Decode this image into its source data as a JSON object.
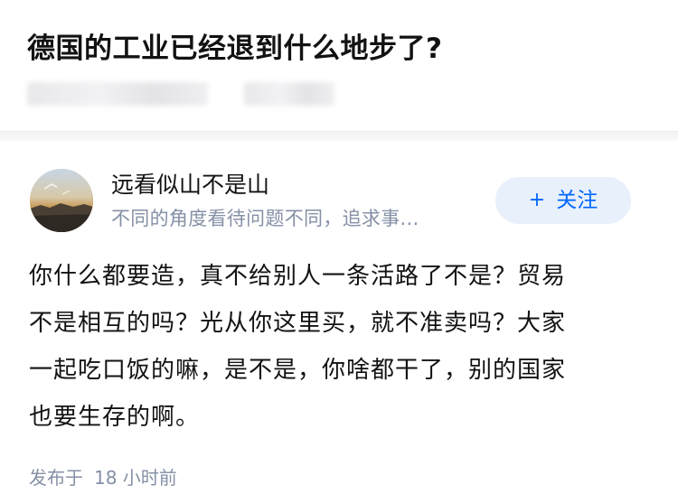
{
  "question": {
    "title": "德国的工业已经退到什么地步了?"
  },
  "answer": {
    "author": {
      "name": "远看似山不是山",
      "bio": "不同的角度看待问题不同，追求事..."
    },
    "follow_button": {
      "icon": "+",
      "label": "关注"
    },
    "content_lines": [
      "你什么都要造，真不给别人一条活路了不是？贸易",
      "不是相互的吗？光从你这里买，就不准卖吗？大家",
      "一起吃口饭的嘛，是不是，你啥都干了，别的国家",
      "也要生存的啊。"
    ],
    "publish": {
      "prefix": "发布于",
      "time": "18 小时前"
    }
  },
  "colors": {
    "accent": "#0066ff",
    "follow_bg": "#e8f1fb",
    "secondary_text": "#8590a6",
    "primary_text": "#121212"
  }
}
